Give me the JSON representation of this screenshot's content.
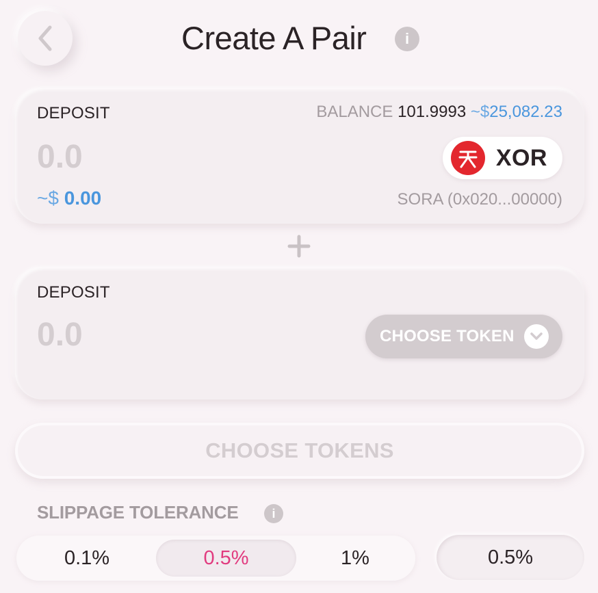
{
  "header": {
    "title": "Create A Pair",
    "info_icon": "info-icon",
    "back_icon": "chevron-left-icon"
  },
  "first_deposit": {
    "label": "DEPOSIT",
    "balance_label": "BALANCE",
    "balance_value": "101.9993",
    "balance_fiat_prefix": "~$",
    "balance_fiat": "25,082.23",
    "amount": "0.0",
    "fiat_prefix": "~$",
    "fiat_value": "0.00",
    "token_symbol": "XOR",
    "token_address": "SORA (0x020...00000)"
  },
  "plus_icon": "plus-icon",
  "second_deposit": {
    "label": "DEPOSIT",
    "amount": "0.0",
    "choose_token_label": "CHOOSE TOKEN"
  },
  "main_button": {
    "label": "CHOOSE TOKENS"
  },
  "slippage": {
    "title": "SLIPPAGE TOLERANCE",
    "options": [
      "0.1%",
      "0.5%",
      "1%"
    ],
    "selected": "0.5%",
    "custom_value": "0.5%"
  },
  "colors": {
    "accent_pink": "#e13b7f",
    "fiat_blue": "#4a96dd",
    "xor_red": "#e3272e"
  }
}
